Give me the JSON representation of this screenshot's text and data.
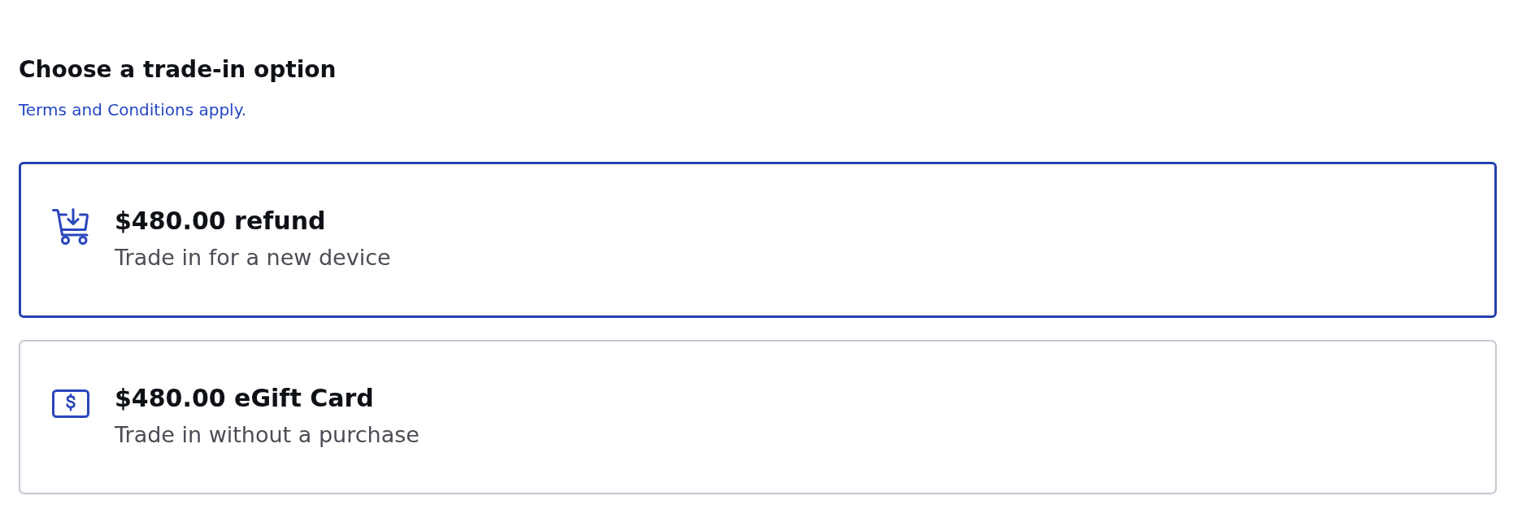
{
  "heading": "Choose a trade-in option",
  "terms_link": "Terms and Conditions apply.",
  "options": [
    {
      "kind": "refund",
      "title": "$480.00 refund",
      "subtitle": "Trade in for a new device",
      "selected": true
    },
    {
      "kind": "egift",
      "title": "$480.00 eGift Card",
      "subtitle": "Trade in without a purchase",
      "selected": false
    }
  ]
}
